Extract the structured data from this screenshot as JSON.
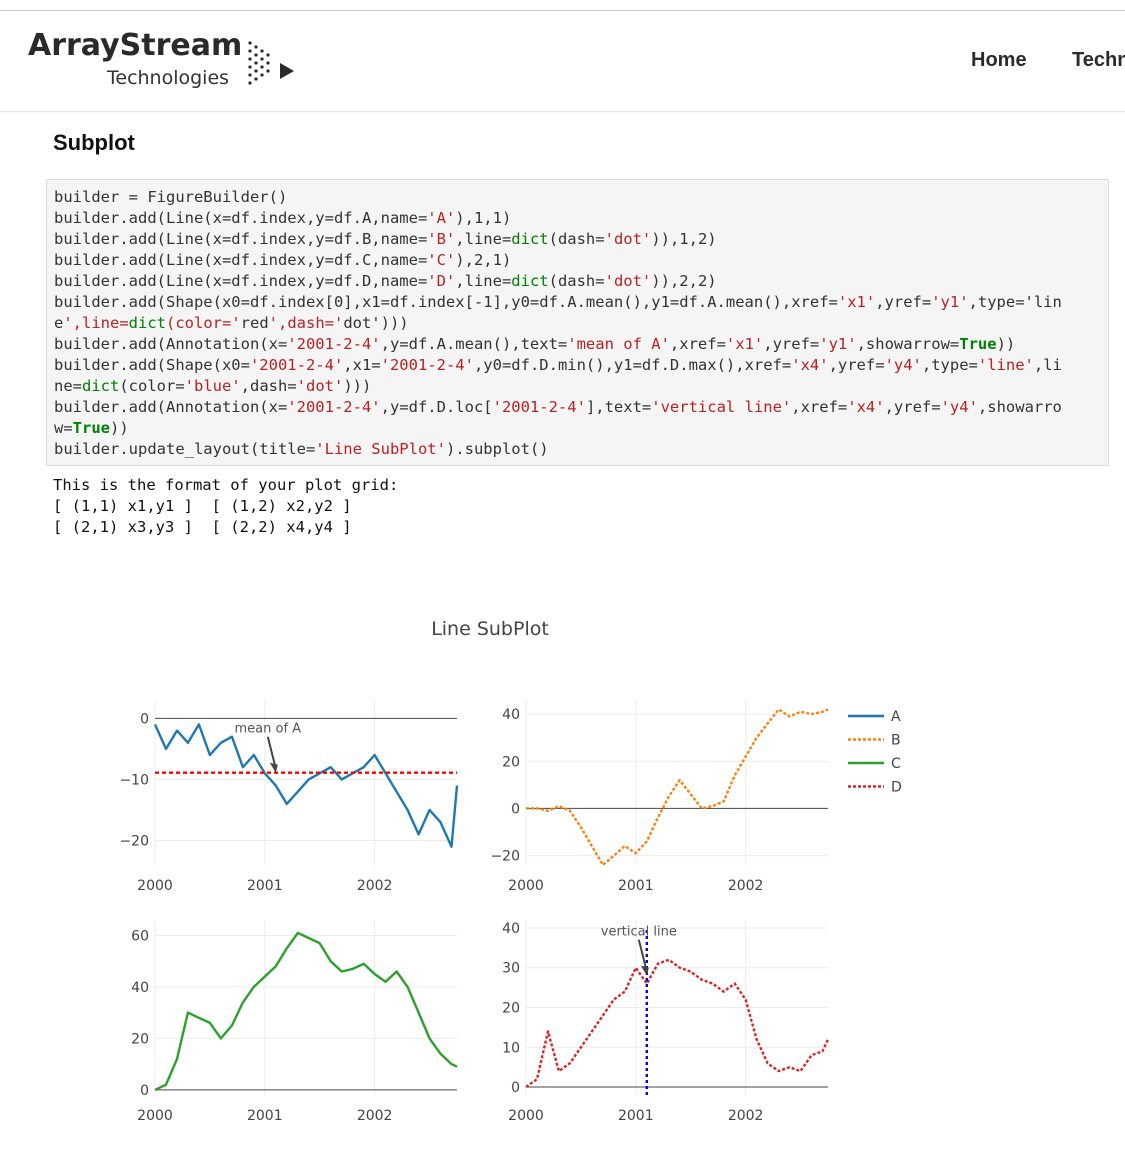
{
  "header": {
    "brand_name": "ArrayStream",
    "brand_tagline": "Technologies",
    "nav": [
      {
        "label": "Home"
      },
      {
        "label": "Techn"
      }
    ]
  },
  "main": {
    "title": "Subplot",
    "code_lines": [
      "builder = FigureBuilder()",
      "builder.add(Line(x=df.index,y=df.A,name='A'),1,1)",
      "builder.add(Line(x=df.index,y=df.B,name='B',line=dict(dash='dot')),1,2)",
      "builder.add(Line(x=df.index,y=df.C,name='C'),2,1)",
      "builder.add(Line(x=df.index,y=df.D,name='D',line=dict(dash='dot')),2,2)",
      "builder.add(Shape(x0=df.index[0],x1=df.index[-1],y0=df.A.mean(),y1=df.A.mean(),xref='x1',yref='y1',type='lin",
      "e',line=dict(color='red',dash='dot')))",
      "builder.add(Annotation(x='2001-2-4',y=df.A.mean(),text='mean of A',xref='x1',yref='y1',showarrow=True))",
      "builder.add(Shape(x0='2001-2-4',x1='2001-2-4',y0=df.D.min(),y1=df.D.max(),xref='x4',yref='y4',type='line',li",
      "ne=dict(color='blue',dash='dot')))",
      "builder.add(Annotation(x='2001-2-4',y=df.D.loc['2001-2-4'],text='vertical line',xref='x4',yref='y4',showarro",
      "w=True))",
      "builder.update_layout(title='Line SubPlot').subplot()"
    ],
    "output_lines": [
      "This is the format of your plot grid:",
      "[ (1,1) x1,y1 ]  [ (1,2) x2,y2 ]",
      "[ (2,1) x3,y3 ]  [ (2,2) x4,y4 ]"
    ]
  },
  "chart_data": {
    "type": "line",
    "title": "Line SubPlot",
    "legend": [
      "A",
      "B",
      "C",
      "D"
    ],
    "legend_placement": "right",
    "colors": {
      "A": "#1f77b4",
      "B": "#ff7f0e",
      "C": "#2ca02c",
      "D": "#d62728",
      "mean_line": "#ff0000",
      "vertical_line": "#0000ff"
    },
    "subplots": [
      {
        "name": "A",
        "dash": "solid",
        "xlim": [
          2000.0,
          2002.75
        ],
        "ylim": [
          -24,
          3
        ],
        "xticks": [
          "2000",
          "2001",
          "2002"
        ],
        "yticks": [
          0,
          -10,
          -20
        ],
        "x": [
          2000.0,
          2000.1,
          2000.2,
          2000.3,
          2000.4,
          2000.5,
          2000.6,
          2000.7,
          2000.8,
          2000.9,
          2001.0,
          2001.1,
          2001.2,
          2001.3,
          2001.4,
          2001.5,
          2001.6,
          2001.7,
          2001.8,
          2001.9,
          2002.0,
          2002.1,
          2002.2,
          2002.3,
          2002.4,
          2002.5,
          2002.6,
          2002.7,
          2002.75
        ],
        "y": [
          -1,
          -5,
          -2,
          -4,
          -1,
          -6,
          -4,
          -3,
          -8,
          -6,
          -9,
          -11,
          -14,
          -12,
          -10,
          -9,
          -8,
          -10,
          -9,
          -8,
          -6,
          -9,
          -12,
          -15,
          -19,
          -15,
          -17,
          -21,
          -11
        ],
        "shapes": [
          {
            "type": "horizontal",
            "y": -8.9,
            "color": "red",
            "dash": "dot"
          }
        ],
        "annotations": [
          {
            "text": "mean of A",
            "x": 2001.1,
            "y": -8.9
          }
        ]
      },
      {
        "name": "B",
        "dash": "dot",
        "xlim": [
          2000.0,
          2002.75
        ],
        "ylim": [
          -24,
          46
        ],
        "xticks": [
          "2000",
          "2001",
          "2002"
        ],
        "yticks": [
          40,
          20,
          0,
          -20
        ],
        "x": [
          2000.0,
          2000.1,
          2000.2,
          2000.3,
          2000.4,
          2000.5,
          2000.6,
          2000.7,
          2000.8,
          2000.9,
          2001.0,
          2001.1,
          2001.2,
          2001.3,
          2001.4,
          2001.5,
          2001.6,
          2001.7,
          2001.8,
          2001.9,
          2002.0,
          2002.1,
          2002.2,
          2002.3,
          2002.4,
          2002.5,
          2002.6,
          2002.7,
          2002.75
        ],
        "y": [
          0,
          0,
          -1,
          1,
          -1,
          -8,
          -16,
          -24,
          -20,
          -16,
          -19,
          -14,
          -4,
          5,
          12,
          6,
          0,
          1,
          3,
          14,
          22,
          30,
          36,
          42,
          39,
          41,
          40,
          41,
          42
        ]
      },
      {
        "name": "C",
        "dash": "solid",
        "xlim": [
          2000.0,
          2002.75
        ],
        "ylim": [
          -2,
          66
        ],
        "xticks": [
          "2000",
          "2001",
          "2002"
        ],
        "yticks": [
          60,
          40,
          20,
          0
        ],
        "x": [
          2000.0,
          2000.1,
          2000.2,
          2000.3,
          2000.4,
          2000.5,
          2000.6,
          2000.7,
          2000.8,
          2000.9,
          2001.0,
          2001.1,
          2001.2,
          2001.3,
          2001.4,
          2001.5,
          2001.6,
          2001.7,
          2001.8,
          2001.9,
          2002.0,
          2002.1,
          2002.2,
          2002.3,
          2002.4,
          2002.5,
          2002.6,
          2002.7,
          2002.75
        ],
        "y": [
          0,
          2,
          12,
          30,
          28,
          26,
          20,
          25,
          34,
          40,
          44,
          48,
          55,
          61,
          59,
          57,
          50,
          46,
          47,
          49,
          45,
          42,
          46,
          40,
          30,
          20,
          14,
          10,
          9
        ]
      },
      {
        "name": "D",
        "dash": "dot",
        "xlim": [
          2000.0,
          2002.75
        ],
        "ylim": [
          -2,
          42
        ],
        "xticks": [
          "2000",
          "2001",
          "2002"
        ],
        "yticks": [
          40,
          30,
          20,
          10,
          0
        ],
        "x": [
          2000.0,
          2000.1,
          2000.2,
          2000.3,
          2000.4,
          2000.5,
          2000.6,
          2000.7,
          2000.8,
          2000.9,
          2001.0,
          2001.1,
          2001.2,
          2001.3,
          2001.4,
          2001.5,
          2001.6,
          2001.7,
          2001.8,
          2001.9,
          2002.0,
          2002.1,
          2002.2,
          2002.3,
          2002.4,
          2002.5,
          2002.6,
          2002.7,
          2002.75
        ],
        "y": [
          0,
          2,
          14,
          4,
          6,
          10,
          14,
          18,
          22,
          24,
          30,
          26,
          31,
          32,
          30,
          29,
          27,
          26,
          24,
          26,
          22,
          12,
          6,
          4,
          5,
          4,
          8,
          9,
          12
        ],
        "shapes": [
          {
            "type": "vertical",
            "x": 2001.1,
            "color": "blue",
            "dash": "dot"
          }
        ],
        "annotations": [
          {
            "text": "vertical line",
            "x": 2001.1,
            "y": 28
          }
        ]
      }
    ]
  }
}
